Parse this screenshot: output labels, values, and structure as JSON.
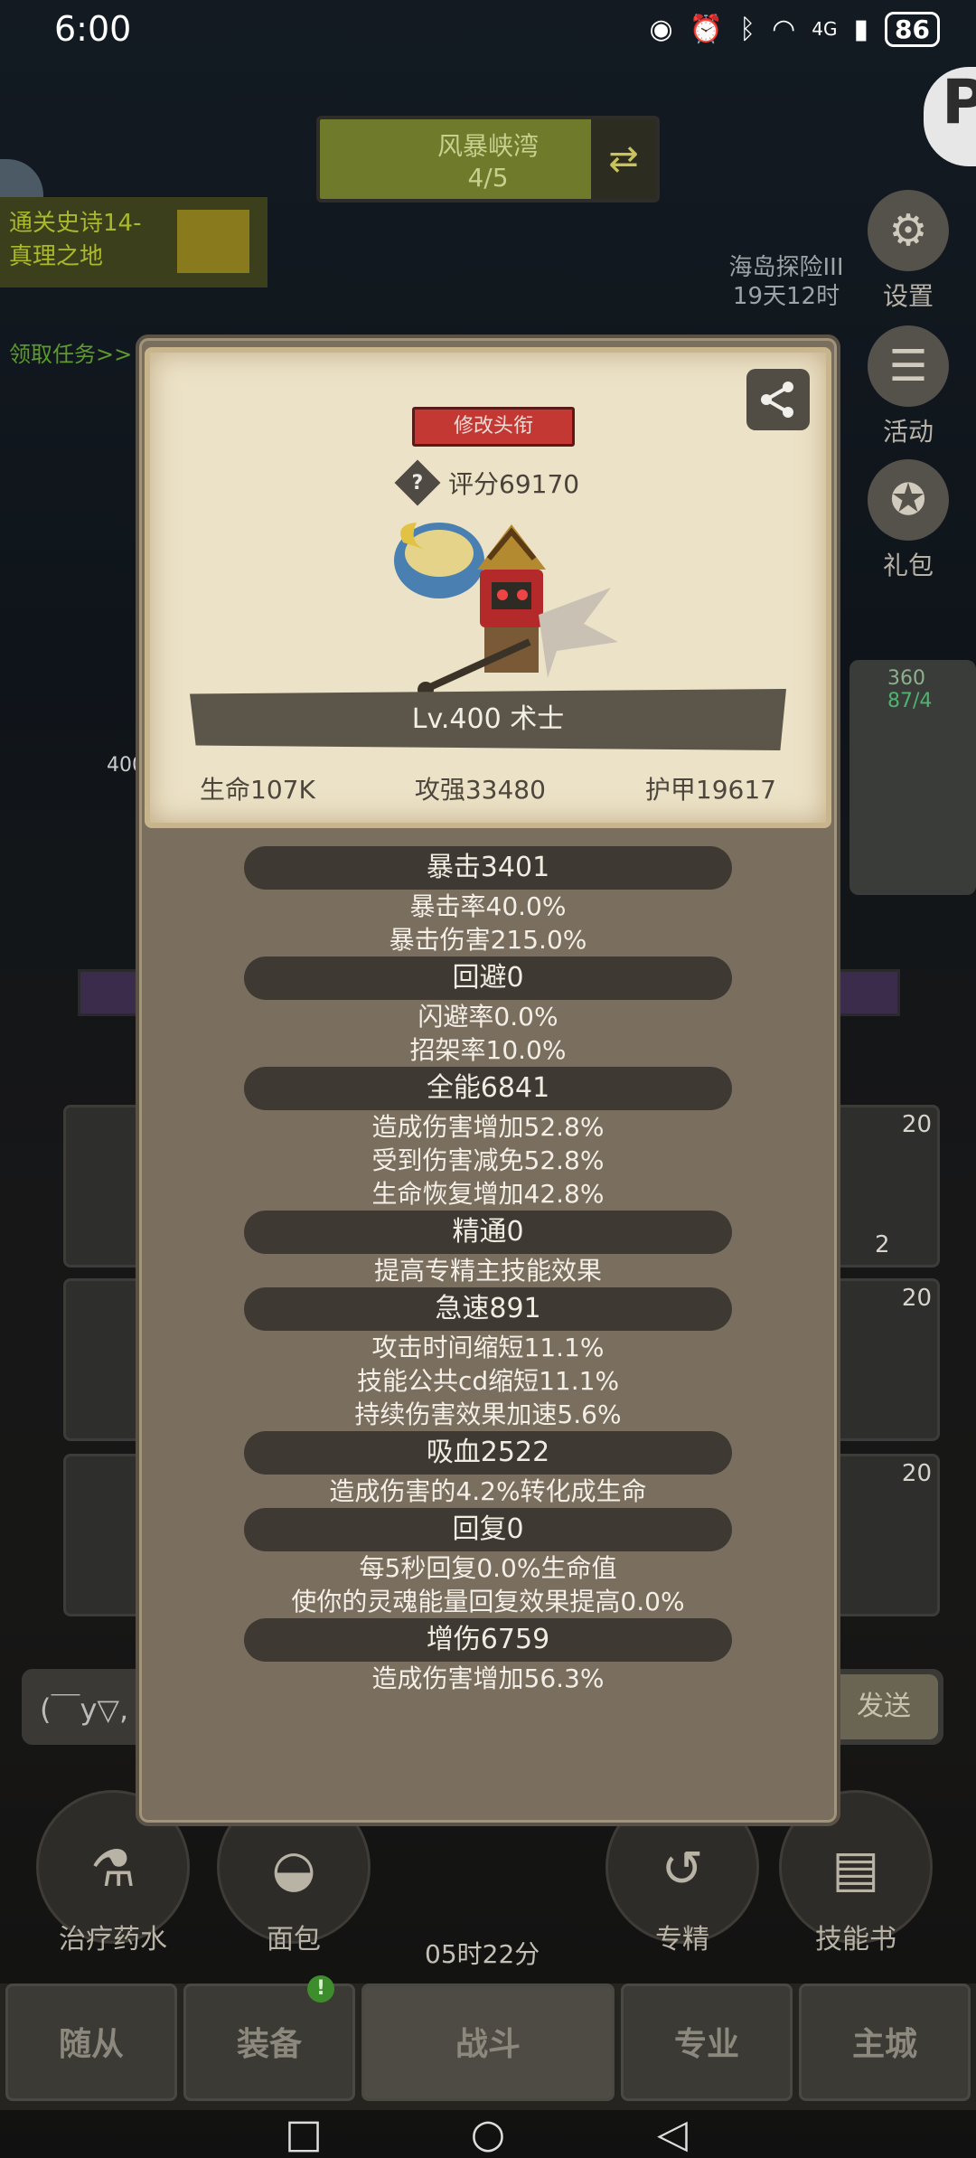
{
  "status_bar": {
    "time": "6:00",
    "network": "4G",
    "battery": "86"
  },
  "background": {
    "map_name": "风暴峡湾",
    "map_progress": "4/5",
    "quest_title": "通关史诗14-\n真理之地",
    "quest_link": "领取任务>>",
    "island_event": "海岛探险III",
    "island_timer": "19天12时",
    "side_buttons": [
      "设置",
      "活动",
      "礼包"
    ],
    "slot_levels": [
      "20",
      "2",
      "20",
      "20"
    ],
    "chat_placeholder": "(￣y▽,",
    "send_label": "发送",
    "items": [
      "治疗药水",
      "面包",
      "专精",
      "技能书"
    ],
    "timer": "05时22分",
    "tabs": [
      "随从",
      "装备",
      "战斗",
      "专业",
      "主城"
    ],
    "tab_badge": "!",
    "bg_numbers": [
      "360",
      "87/4",
      "400"
    ]
  },
  "profile": {
    "edit_title_label": "修改头衔",
    "score": "评分69170",
    "level_class": "Lv.400 术士",
    "hp": "生命107K",
    "attack": "攻强33480",
    "armor": "护甲19617"
  },
  "stats": [
    {
      "head": "暴击3401",
      "lines": [
        "暴击率40.0%",
        "暴击伤害215.0%"
      ]
    },
    {
      "head": "回避0",
      "lines": [
        "闪避率0.0%",
        "招架率10.0%"
      ]
    },
    {
      "head": "全能6841",
      "lines": [
        "造成伤害增加52.8%",
        "受到伤害减免52.8%",
        "生命恢复增加42.8%"
      ]
    },
    {
      "head": "精通0",
      "lines": [
        "提高专精主技能效果"
      ]
    },
    {
      "head": "急速891",
      "lines": [
        "攻击时间缩短11.1%",
        "技能公共cd缩短11.1%",
        "持续伤害效果加速5.6%"
      ]
    },
    {
      "head": "吸血2522",
      "lines": [
        "造成伤害的4.2%转化成生命"
      ]
    },
    {
      "head": "回复0",
      "lines": [
        "每5秒回复0.0%生命值",
        "使你的灵魂能量回复效果提高0.0%"
      ]
    },
    {
      "head": "增伤6759",
      "lines": [
        "造成伤害增加56.3%"
      ]
    }
  ]
}
